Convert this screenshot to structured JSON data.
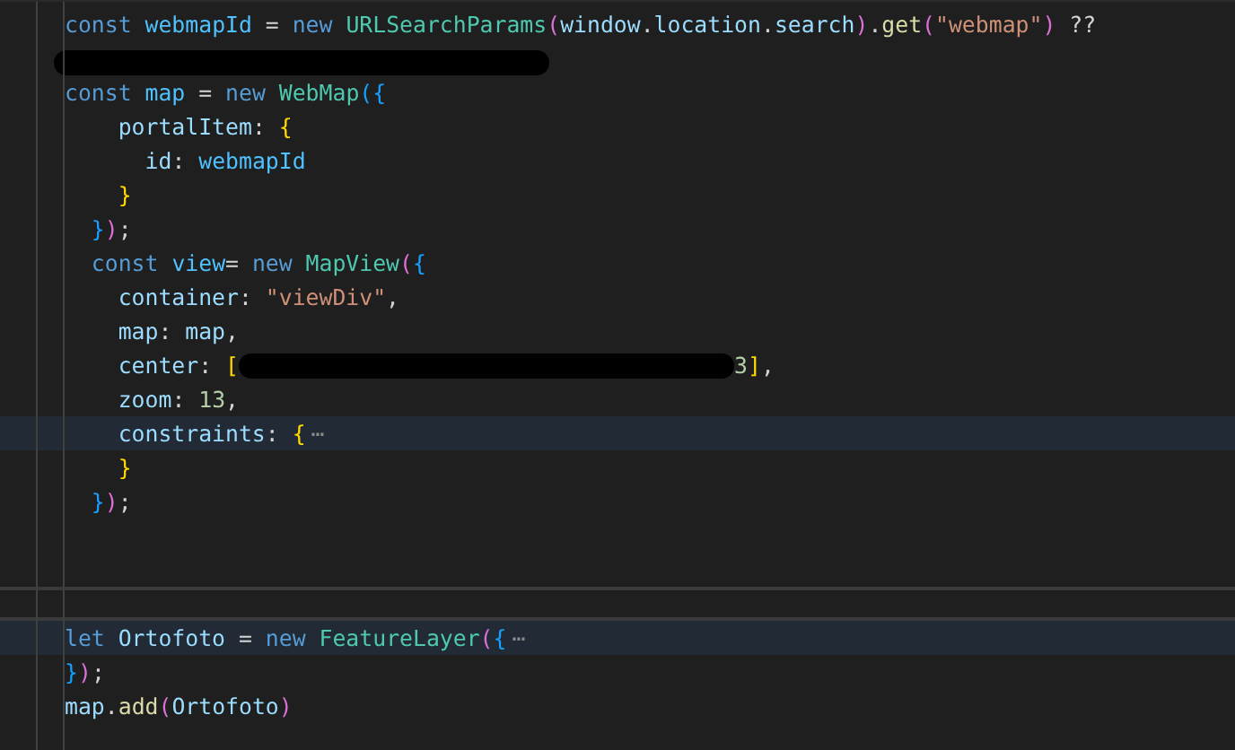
{
  "editor": {
    "lines": [
      {
        "highlighted": false,
        "cursor": false,
        "tokens": [
          {
            "kind": "keyword",
            "text": "const "
          },
          {
            "kind": "constant",
            "text": "webmapId"
          },
          {
            "kind": "plain",
            "text": " = "
          },
          {
            "kind": "keyword",
            "text": "new "
          },
          {
            "kind": "class",
            "text": "URLSearchParams"
          },
          {
            "kind": "bracket-pink",
            "text": "("
          },
          {
            "kind": "property",
            "text": "window"
          },
          {
            "kind": "plain",
            "text": "."
          },
          {
            "kind": "property",
            "text": "location"
          },
          {
            "kind": "plain",
            "text": "."
          },
          {
            "kind": "property",
            "text": "search"
          },
          {
            "kind": "bracket-pink",
            "text": ")"
          },
          {
            "kind": "plain",
            "text": "."
          },
          {
            "kind": "function",
            "text": "get"
          },
          {
            "kind": "bracket-pink",
            "text": "("
          },
          {
            "kind": "string",
            "text": "\"webmap\""
          },
          {
            "kind": "bracket-pink",
            "text": ")"
          },
          {
            "kind": "plain",
            "text": " ??"
          }
        ]
      },
      {
        "highlighted": false,
        "cursor": false,
        "tokens": [
          {
            "kind": "redaction"
          }
        ]
      },
      {
        "highlighted": false,
        "cursor": false,
        "tokens": [
          {
            "kind": "keyword",
            "text": "const "
          },
          {
            "kind": "constant",
            "text": "map"
          },
          {
            "kind": "plain",
            "text": " = "
          },
          {
            "kind": "keyword",
            "text": "new "
          },
          {
            "kind": "class",
            "text": "WebMap"
          },
          {
            "kind": "bracket-blue",
            "text": "({"
          }
        ]
      },
      {
        "highlighted": false,
        "cursor": false,
        "tokens": [
          {
            "kind": "property",
            "text": "    portalItem"
          },
          {
            "kind": "plain",
            "text": ": "
          },
          {
            "kind": "bracket-gold",
            "text": "{"
          }
        ]
      },
      {
        "highlighted": false,
        "cursor": false,
        "tokens": [
          {
            "kind": "property",
            "text": "      id"
          },
          {
            "kind": "plain",
            "text": ": "
          },
          {
            "kind": "constant",
            "text": "webmapId"
          }
        ]
      },
      {
        "highlighted": false,
        "cursor": false,
        "tokens": [
          {
            "kind": "bracket-gold",
            "text": "    }"
          }
        ]
      },
      {
        "highlighted": false,
        "cursor": false,
        "tokens": [
          {
            "kind": "bracket-blue",
            "text": "  }"
          },
          {
            "kind": "bracket-pink",
            "text": ")"
          },
          {
            "kind": "plain",
            "text": ";"
          }
        ]
      },
      {
        "highlighted": false,
        "cursor": false,
        "tokens": [
          {
            "kind": "keyword",
            "text": "  const "
          },
          {
            "kind": "constant",
            "text": "view"
          },
          {
            "kind": "plain",
            "text": "= "
          },
          {
            "kind": "keyword",
            "text": "new "
          },
          {
            "kind": "class",
            "text": "MapView"
          },
          {
            "kind": "bracket-pink",
            "text": "("
          },
          {
            "kind": "bracket-blue",
            "text": "{"
          }
        ]
      },
      {
        "highlighted": false,
        "cursor": false,
        "tokens": [
          {
            "kind": "property",
            "text": "    container"
          },
          {
            "kind": "plain",
            "text": ": "
          },
          {
            "kind": "string",
            "text": "\"viewDiv\""
          },
          {
            "kind": "plain",
            "text": ","
          }
        ]
      },
      {
        "highlighted": false,
        "cursor": false,
        "tokens": [
          {
            "kind": "property",
            "text": "    map"
          },
          {
            "kind": "plain",
            "text": ": "
          },
          {
            "kind": "property",
            "text": "map"
          },
          {
            "kind": "plain",
            "text": ","
          }
        ]
      },
      {
        "highlighted": false,
        "cursor": false,
        "tokens": [
          {
            "kind": "property",
            "text": "    center"
          },
          {
            "kind": "plain",
            "text": ": "
          },
          {
            "kind": "bracket-gold",
            "text": "["
          },
          {
            "kind": "redaction"
          },
          {
            "kind": "number",
            "text": "3"
          },
          {
            "kind": "bracket-gold",
            "text": "]"
          },
          {
            "kind": "plain",
            "text": ","
          }
        ]
      },
      {
        "highlighted": false,
        "cursor": false,
        "tokens": [
          {
            "kind": "property",
            "text": "    zoom"
          },
          {
            "kind": "plain",
            "text": ": "
          },
          {
            "kind": "number",
            "text": "13"
          },
          {
            "kind": "plain",
            "text": ","
          }
        ]
      },
      {
        "highlighted": true,
        "cursor": false,
        "tokens": [
          {
            "kind": "property",
            "text": "    constraints"
          },
          {
            "kind": "plain",
            "text": ": "
          },
          {
            "kind": "bracket-gold",
            "text": "{"
          },
          {
            "kind": "fold",
            "text": "⋯"
          }
        ]
      },
      {
        "highlighted": false,
        "cursor": false,
        "tokens": [
          {
            "kind": "bracket-gold",
            "text": "    }"
          }
        ]
      },
      {
        "highlighted": false,
        "cursor": false,
        "tokens": [
          {
            "kind": "bracket-blue",
            "text": "  }"
          },
          {
            "kind": "bracket-pink",
            "text": ")"
          },
          {
            "kind": "plain",
            "text": ";"
          }
        ]
      },
      {
        "highlighted": false,
        "cursor": false
      },
      {
        "highlighted": false,
        "cursor": false
      },
      {
        "highlighted": false,
        "cursor": true
      },
      {
        "highlighted": true,
        "cursor": false,
        "tokens": [
          {
            "kind": "keyword",
            "text": "let "
          },
          {
            "kind": "property",
            "text": "Ortofoto"
          },
          {
            "kind": "plain",
            "text": " = "
          },
          {
            "kind": "keyword",
            "text": "new "
          },
          {
            "kind": "class",
            "text": "FeatureLayer"
          },
          {
            "kind": "bracket-pink",
            "text": "("
          },
          {
            "kind": "bracket-blue",
            "text": "{"
          },
          {
            "kind": "fold",
            "text": "⋯"
          }
        ]
      },
      {
        "highlighted": false,
        "cursor": false,
        "tokens": [
          {
            "kind": "bracket-blue",
            "text": "}"
          },
          {
            "kind": "bracket-pink",
            "text": ")"
          },
          {
            "kind": "plain",
            "text": ";"
          }
        ]
      },
      {
        "highlighted": false,
        "cursor": false,
        "tokens": [
          {
            "kind": "property",
            "text": "map"
          },
          {
            "kind": "plain",
            "text": "."
          },
          {
            "kind": "function",
            "text": "add"
          },
          {
            "kind": "bracket-pink",
            "text": "("
          },
          {
            "kind": "property",
            "text": "Ortofoto"
          },
          {
            "kind": "bracket-pink",
            "text": ")"
          }
        ]
      }
    ]
  }
}
